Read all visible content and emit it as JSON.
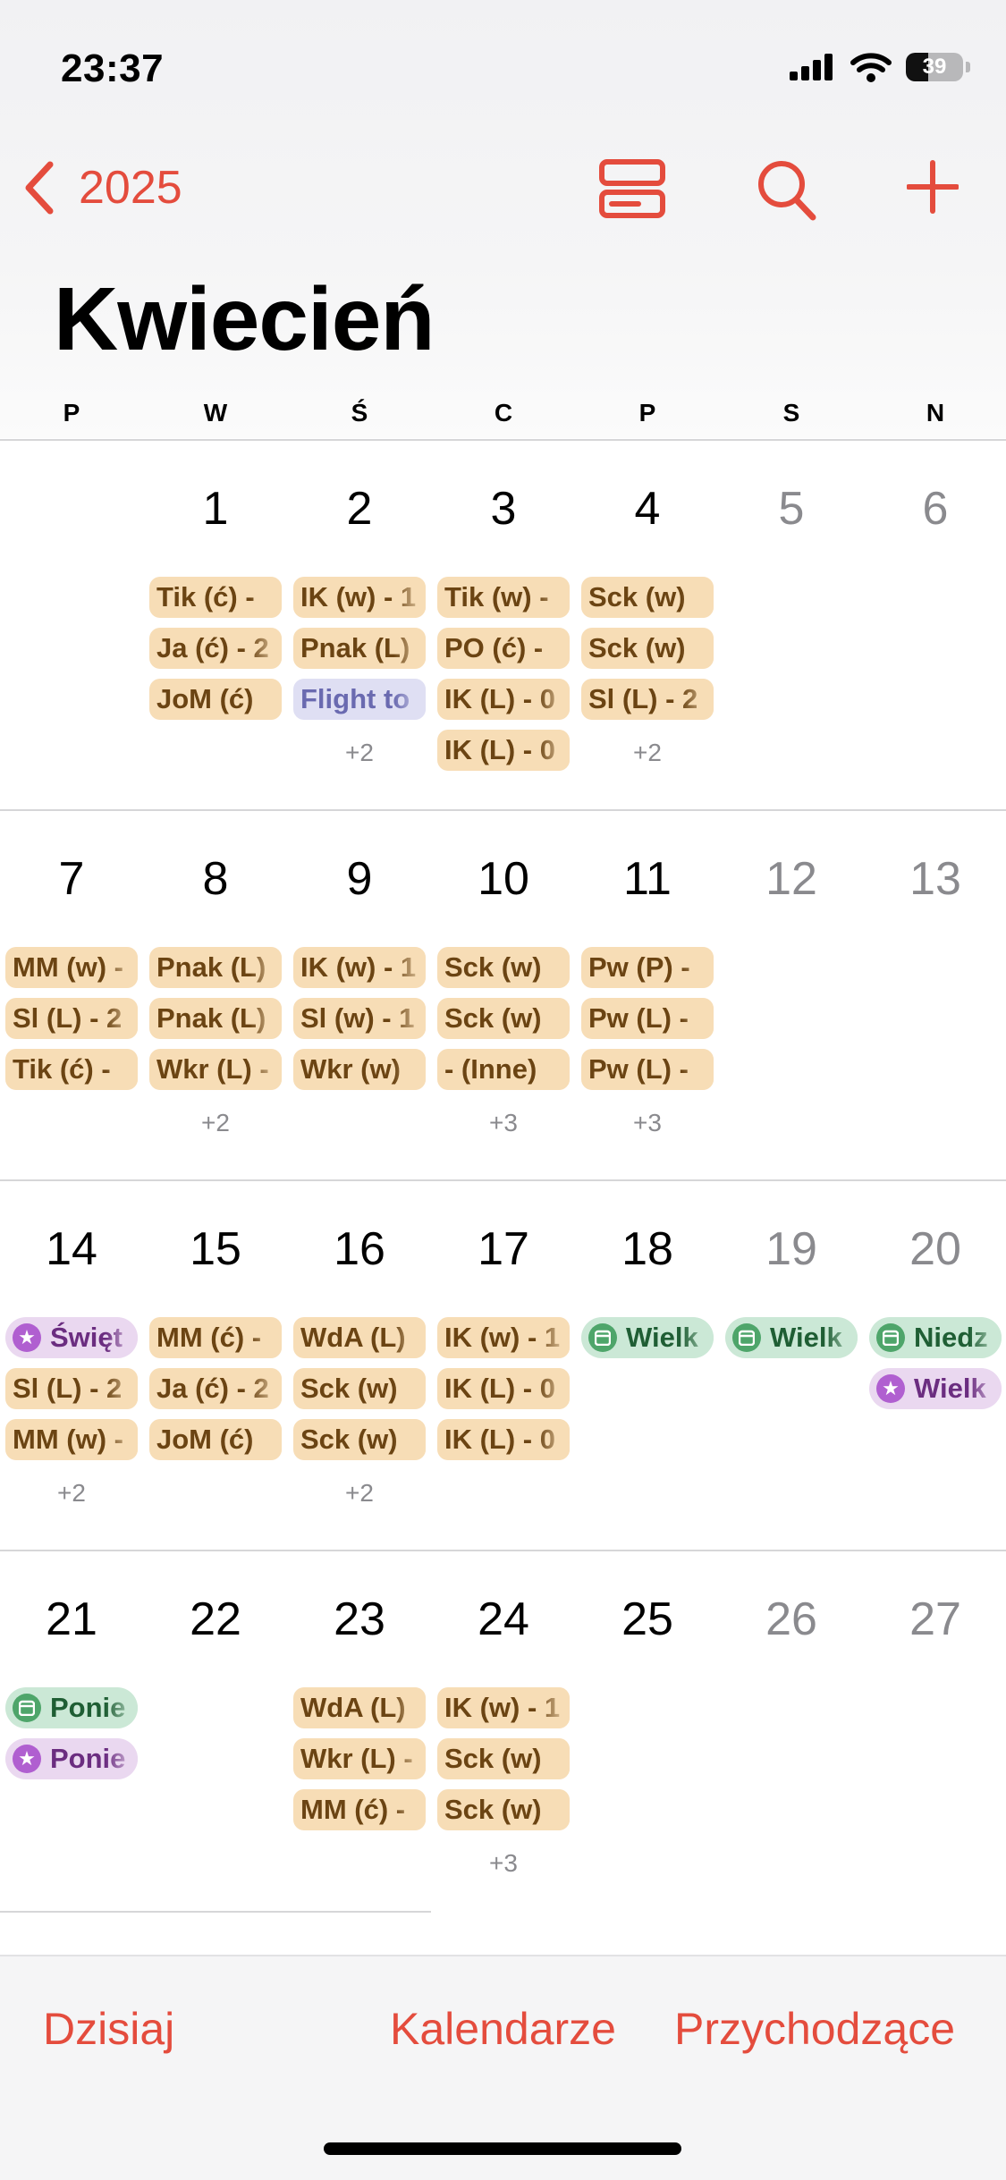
{
  "status": {
    "time": "23:37",
    "battery": "39"
  },
  "nav": {
    "year": "2025"
  },
  "month_title": "Kwiecień",
  "weekdays": [
    "P",
    "W",
    "Ś",
    "C",
    "P",
    "S",
    "N"
  ],
  "weeks": [
    {
      "days": [
        {
          "num": "",
          "events": [],
          "more": ""
        },
        {
          "num": "1",
          "events": [
            {
              "text": "Tik (ć) - ",
              "c": "orange"
            },
            {
              "text": "Ja (ć) - 2",
              "c": "orange"
            },
            {
              "text": "JoM (ć)",
              "c": "orange"
            }
          ],
          "more": ""
        },
        {
          "num": "2",
          "events": [
            {
              "text": "IK (w) - 1",
              "c": "orange"
            },
            {
              "text": "Pnak (L)",
              "c": "orange"
            },
            {
              "text": "Flight to",
              "c": "blue"
            }
          ],
          "more": "+2"
        },
        {
          "num": "3",
          "events": [
            {
              "text": "Tik (w) - ",
              "c": "orange"
            },
            {
              "text": "PO (ć) - ",
              "c": "orange"
            },
            {
              "text": "IK (L) - 0",
              "c": "orange"
            },
            {
              "text": "IK (L) - 0",
              "c": "orange"
            }
          ],
          "more": ""
        },
        {
          "num": "4",
          "events": [
            {
              "text": "Sck (w)",
              "c": "orange"
            },
            {
              "text": "Sck (w)",
              "c": "orange"
            },
            {
              "text": "Sl (L) - 2",
              "c": "orange"
            }
          ],
          "more": "+2"
        },
        {
          "num": "5",
          "weekend": true,
          "events": [],
          "more": ""
        },
        {
          "num": "6",
          "weekend": true,
          "events": [],
          "more": ""
        }
      ]
    },
    {
      "days": [
        {
          "num": "7",
          "events": [
            {
              "text": "MM (w) - ",
              "c": "orange"
            },
            {
              "text": "Sl (L) - 2",
              "c": "orange"
            },
            {
              "text": "Tik (ć) - ",
              "c": "orange"
            }
          ],
          "more": ""
        },
        {
          "num": "8",
          "events": [
            {
              "text": "Pnak (L)",
              "c": "orange"
            },
            {
              "text": "Pnak (L)",
              "c": "orange"
            },
            {
              "text": "Wkr (L) - ",
              "c": "orange"
            }
          ],
          "more": "+2"
        },
        {
          "num": "9",
          "events": [
            {
              "text": "IK (w) - 1",
              "c": "orange"
            },
            {
              "text": "Sl (w) - 1",
              "c": "orange"
            },
            {
              "text": "Wkr (w)",
              "c": "orange"
            }
          ],
          "more": ""
        },
        {
          "num": "10",
          "events": [
            {
              "text": "Sck (w)",
              "c": "orange"
            },
            {
              "text": "Sck (w)",
              "c": "orange"
            },
            {
              "text": "- (Inne)",
              "c": "orange"
            }
          ],
          "more": "+3"
        },
        {
          "num": "11",
          "events": [
            {
              "text": "Pw (P) - ",
              "c": "orange"
            },
            {
              "text": "Pw (L) - ",
              "c": "orange"
            },
            {
              "text": "Pw (L) - ",
              "c": "orange"
            }
          ],
          "more": "+3"
        },
        {
          "num": "12",
          "weekend": true,
          "events": [],
          "more": ""
        },
        {
          "num": "13",
          "weekend": true,
          "events": [],
          "more": ""
        }
      ]
    },
    {
      "days": [
        {
          "num": "14",
          "events": [
            {
              "text": "Święt",
              "c": "purple"
            },
            {
              "text": "Sl (L) - 2",
              "c": "orange"
            },
            {
              "text": "MM (w) - ",
              "c": "orange"
            }
          ],
          "more": "+2"
        },
        {
          "num": "15",
          "events": [
            {
              "text": "MM (ć) - ",
              "c": "orange"
            },
            {
              "text": "Ja (ć) - 2",
              "c": "orange"
            },
            {
              "text": "JoM (ć)",
              "c": "orange"
            }
          ],
          "more": ""
        },
        {
          "num": "16",
          "events": [
            {
              "text": "WdA (L)",
              "c": "orange"
            },
            {
              "text": "Sck (w)",
              "c": "orange"
            },
            {
              "text": "Sck (w)",
              "c": "orange"
            }
          ],
          "more": "+2"
        },
        {
          "num": "17",
          "events": [
            {
              "text": "IK (w) - 1",
              "c": "orange"
            },
            {
              "text": "IK (L) - 0",
              "c": "orange"
            },
            {
              "text": "IK (L) - 0",
              "c": "orange"
            }
          ],
          "more": ""
        },
        {
          "num": "18",
          "events": [
            {
              "text": "Wielk",
              "c": "green"
            }
          ],
          "more": ""
        },
        {
          "num": "19",
          "weekend": true,
          "events": [
            {
              "text": "Wielk",
              "c": "green"
            }
          ],
          "more": ""
        },
        {
          "num": "20",
          "weekend": true,
          "events": [
            {
              "text": "Niedz",
              "c": "green"
            },
            {
              "text": "Wielk",
              "c": "purple"
            }
          ],
          "more": ""
        }
      ]
    },
    {
      "days": [
        {
          "num": "21",
          "events": [
            {
              "text": "Ponie",
              "c": "green"
            },
            {
              "text": "Ponie",
              "c": "purple"
            }
          ],
          "more": ""
        },
        {
          "num": "22",
          "events": [],
          "more": ""
        },
        {
          "num": "23",
          "events": [
            {
              "text": "WdA (L)",
              "c": "orange"
            },
            {
              "text": "Wkr (L) - ",
              "c": "orange"
            },
            {
              "text": "MM (ć) - ",
              "c": "orange"
            }
          ],
          "more": ""
        },
        {
          "num": "24",
          "events": [
            {
              "text": "IK (w) - 1",
              "c": "orange"
            },
            {
              "text": "Sck (w)",
              "c": "orange"
            },
            {
              "text": "Sck (w)",
              "c": "orange"
            }
          ],
          "more": "+3"
        },
        {
          "num": "25",
          "events": [],
          "more": ""
        },
        {
          "num": "26",
          "weekend": true,
          "events": [],
          "more": ""
        },
        {
          "num": "27",
          "weekend": true,
          "events": [],
          "more": ""
        }
      ]
    }
  ],
  "tabs": {
    "today": "Dzisiaj",
    "calendars": "Kalendarze",
    "inbox": "Przychodzące"
  },
  "colors": {
    "accent": "#e44c3d",
    "event_orange": "#f7ddb6",
    "event_green": "#cbe8d6",
    "event_purple": "#ead8f0",
    "event_blue": "#dfdff3"
  }
}
